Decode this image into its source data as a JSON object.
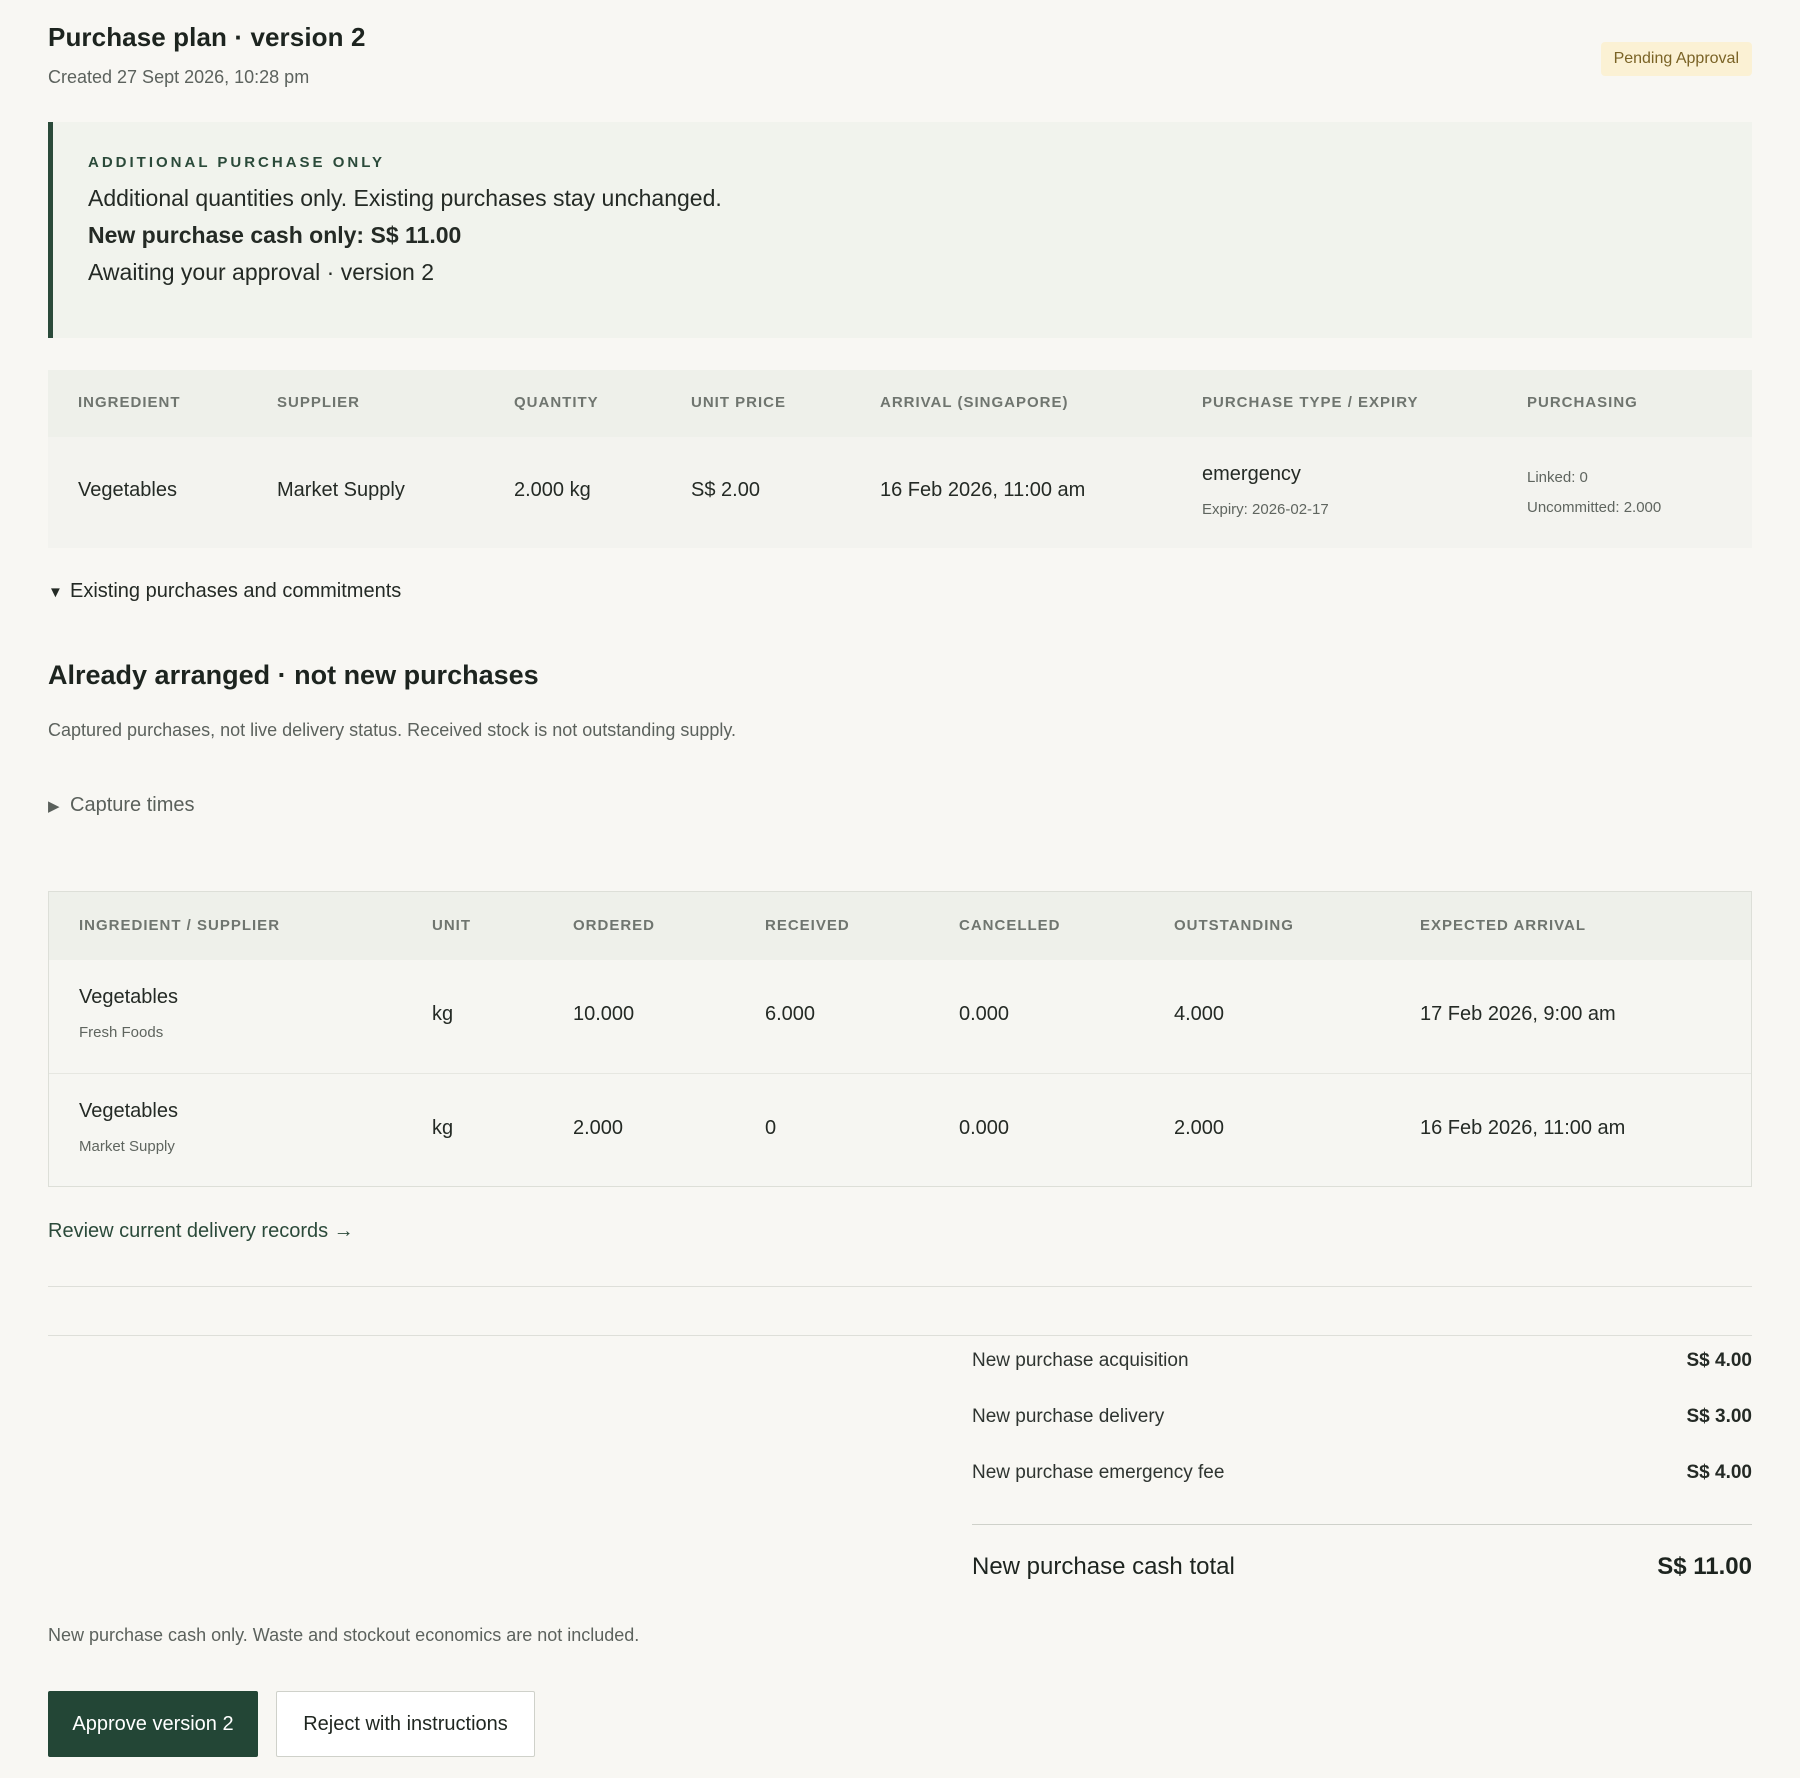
{
  "header": {
    "title": "Purchase plan · version 2",
    "created": "Created 27 Sept 2026, 10:28 pm",
    "status_badge": "Pending Approval"
  },
  "notice": {
    "kicker": "ADDITIONAL PURCHASE ONLY",
    "line1": "Additional quantities only. Existing purchases stay unchanged.",
    "line2": "New purchase cash only: S$ 11.00",
    "line3": "Awaiting your approval · version 2"
  },
  "plan_table": {
    "columns": [
      "INGREDIENT",
      "SUPPLIER",
      "QUANTITY",
      "UNIT PRICE",
      "ARRIVAL (SINGAPORE)",
      "PURCHASE TYPE / EXPIRY",
      "PURCHASING"
    ],
    "row": {
      "ingredient": "Vegetables",
      "supplier": "Market Supply",
      "quantity": "2.000 kg",
      "unit_price": "S$ 2.00",
      "arrival": "16 Feb 2026, 11:00 am",
      "purchase_type": "emergency",
      "expiry": "Expiry: 2026-02-17",
      "linked": "Linked: 0",
      "uncommitted": "Uncommitted: 2.000"
    }
  },
  "existing_toggle": "Existing purchases and commitments",
  "arranged": {
    "heading": "Already arranged · not new purchases",
    "subtitle": "Captured purchases, not live delivery status. Received stock is not outstanding supply.",
    "capture_toggle": "Capture times"
  },
  "existing_table": {
    "columns": [
      "INGREDIENT / SUPPLIER",
      "UNIT",
      "ORDERED",
      "RECEIVED",
      "CANCELLED",
      "OUTSTANDING",
      "EXPECTED ARRIVAL"
    ],
    "rows": [
      {
        "ingredient": "Vegetables",
        "supplier": "Fresh Foods",
        "unit": "kg",
        "ordered": "10.000",
        "received": "6.000",
        "cancelled": "0.000",
        "outstanding": "4.000",
        "expected": "17 Feb 2026, 9:00 am"
      },
      {
        "ingredient": "Vegetables",
        "supplier": "Market Supply",
        "unit": "kg",
        "ordered": "2.000",
        "received": "0",
        "cancelled": "0.000",
        "outstanding": "2.000",
        "expected": "16 Feb 2026, 11:00 am"
      }
    ]
  },
  "review_link": "Review current delivery records →",
  "totals": {
    "items": [
      {
        "label": "New purchase acquisition",
        "value": "S$ 4.00"
      },
      {
        "label": "New purchase delivery",
        "value": "S$ 3.00"
      },
      {
        "label": "New purchase emergency fee",
        "value": "S$ 4.00"
      }
    ],
    "total_label": "New purchase cash total",
    "total_value": "S$ 11.00"
  },
  "footnote": "New purchase cash only. Waste and stockout economics are not included.",
  "actions": {
    "approve": "Approve version 2",
    "reject": "Reject with instructions"
  }
}
